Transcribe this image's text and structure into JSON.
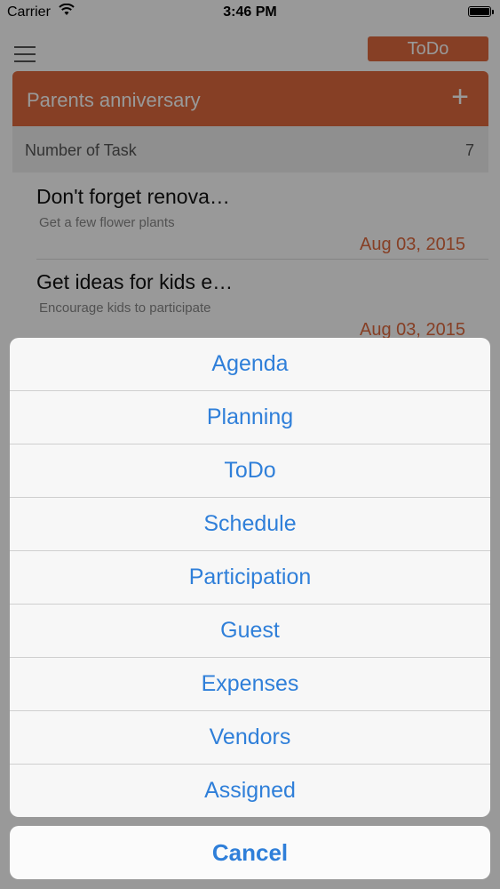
{
  "status_bar": {
    "carrier": "Carrier",
    "time": "3:46 PM"
  },
  "header": {
    "view_button_label": "ToDo"
  },
  "event": {
    "title": "Parents anniversary",
    "add_symbol": "+"
  },
  "task_count": {
    "label": "Number of Task",
    "value": "7"
  },
  "tasks": [
    {
      "title": "Don't forget renova…",
      "subtitle": "Get a few flower plants",
      "date": "Aug 03, 2015"
    },
    {
      "title": "Get ideas for kids e…",
      "subtitle": "Encourage kids to participate",
      "date": "Aug 03, 2015"
    }
  ],
  "action_sheet": {
    "items": [
      "Agenda",
      "Planning",
      "ToDo",
      "Schedule",
      "Participation",
      "Guest",
      "Expenses",
      "Vendors",
      "Assigned"
    ],
    "cancel_label": "Cancel"
  },
  "colors": {
    "accent": "#e06a3e",
    "action_text": "#2f7fd9"
  },
  "icons": {
    "menu": "hamburger-icon",
    "wifi": "wifi-icon",
    "battery": "battery-icon",
    "add": "plus-icon"
  }
}
